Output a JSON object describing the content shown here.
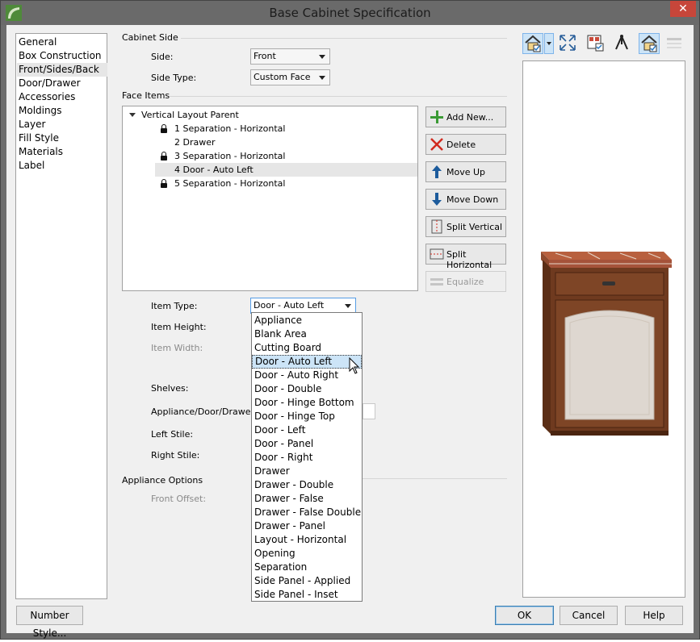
{
  "window": {
    "title": "Base Cabinet Specification",
    "close_glyph": "✕"
  },
  "categories": [
    "General",
    "Box Construction",
    "Front/Sides/Back",
    "Door/Drawer",
    "Accessories",
    "Moldings",
    "Layer",
    "Fill Style",
    "Materials",
    "Label"
  ],
  "selected_category": "Front/Sides/Back",
  "cabinet_side": {
    "group_label": "Cabinet Side",
    "side_label": "Side:",
    "side_value": "Front",
    "side_type_label": "Side Type:",
    "side_type_value": "Custom Face"
  },
  "face_items": {
    "group_label": "Face Items",
    "parent": "Vertical Layout Parent",
    "items": [
      {
        "label": "1 Separation - Horizontal",
        "locked": true
      },
      {
        "label": "2 Drawer",
        "locked": false
      },
      {
        "label": "3 Separation - Horizontal",
        "locked": true
      },
      {
        "label": "4 Door - Auto Left",
        "locked": false,
        "selected": true
      },
      {
        "label": "5 Separation - Horizontal",
        "locked": true
      }
    ]
  },
  "buttons": {
    "add_new": "Add New...",
    "delete": "Delete",
    "move_up": "Move Up",
    "move_down": "Move Down",
    "split_vertical": "Split Vertical",
    "split_horizontal": "Split Horizontal",
    "equalize": "Equalize"
  },
  "item_props": {
    "item_type_label": "Item Type:",
    "item_type_value": "Door - Auto Left",
    "item_height_label": "Item Height:",
    "item_width_label": "Item Width:",
    "shelves_label": "Shelves:",
    "appliance_door_drawer_label": "Appliance/Door/Drawer:",
    "left_stile_label": "Left Stile:",
    "right_stile_label": "Right Stile:"
  },
  "appliance_options": {
    "group_label": "Appliance Options",
    "front_offset_label": "Front Offset:"
  },
  "item_type_options": [
    "Appliance",
    "Blank Area",
    "Cutting Board",
    "Door - Auto Left",
    "Door - Auto Right",
    "Door - Double",
    "Door - Hinge Bottom",
    "Door - Hinge Top",
    "Door - Left",
    "Door - Panel",
    "Door - Right",
    "Drawer",
    "Drawer - Double",
    "Drawer - False",
    "Drawer - False Double",
    "Drawer - Panel",
    "Layout - Horizontal",
    "Opening",
    "Separation",
    "Side Panel - Applied",
    "Side Panel - Inset"
  ],
  "item_type_selected_index": 3,
  "footer": {
    "number_style": "Number Style...",
    "ok": "OK",
    "cancel": "Cancel",
    "help": "Help"
  },
  "colors": {
    "accent": "#569de5",
    "selection": "#cce4f7",
    "title_bar": "#6a6a6a",
    "close_button": "#c7463a"
  }
}
